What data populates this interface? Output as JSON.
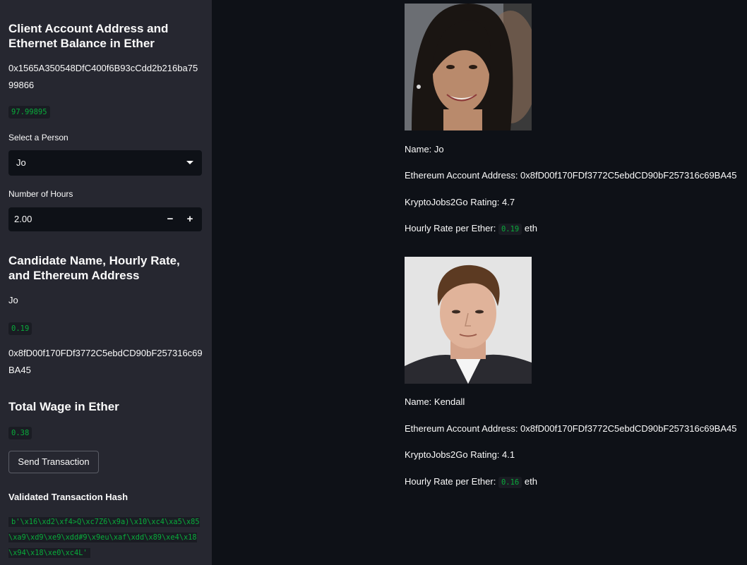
{
  "sidebar": {
    "account_heading": "Client Account Address and Ethernet Balance in Ether",
    "account_address": "0x1565A350548DfC400f6B93cCdd2b216ba7599866",
    "balance": "97.99895",
    "select_label": "Select a Person",
    "select_value": "Jo",
    "hours_label": "Number of Hours",
    "hours_value": "2.00",
    "minus_label": "−",
    "plus_label": "+",
    "candidate_heading": "Candidate Name, Hourly Rate, and Ethereum Address",
    "candidate_name": "Jo",
    "candidate_rate": "0.19",
    "candidate_address": "0x8fD00f170FDf3772C5ebdCD90bF257316c69BA45",
    "wage_heading": "Total Wage in Ether",
    "wage_value": "0.38",
    "send_button": "Send Transaction",
    "hash_heading": "Validated Transaction Hash",
    "hash_value": "b'\\x16\\xd2\\xf4>Q\\xc7Z6\\x9a)\\x10\\xc4\\xa5\\x85\\xa9\\xd9\\xe9\\xdd#9\\x9eu\\xaf\\xdd\\x89\\xe4\\x18\\x94\\x18\\xe0\\xc4L'"
  },
  "candidates": [
    {
      "name_line": "Name: Jo",
      "address_line": "Ethereum Account Address: 0x8fD00f170FDf3772C5ebdCD90bF257316c69BA45",
      "rating_line": "KryptoJobs2Go Rating: 4.7",
      "rate_prefix": "Hourly Rate per Ether:",
      "rate_value": "0.19",
      "rate_suffix": "eth"
    },
    {
      "name_line": "Name: Kendall",
      "address_line": "Ethereum Account Address: 0x8fD00f170FDf3772C5ebdCD90bF257316c69BA45",
      "rating_line": "KryptoJobs2Go Rating: 4.1",
      "rate_prefix": "Hourly Rate per Ether:",
      "rate_value": "0.16",
      "rate_suffix": "eth"
    }
  ],
  "colors": {
    "background": "#0e1117",
    "sidebar": "#262730",
    "code_text": "#09ab3b"
  }
}
